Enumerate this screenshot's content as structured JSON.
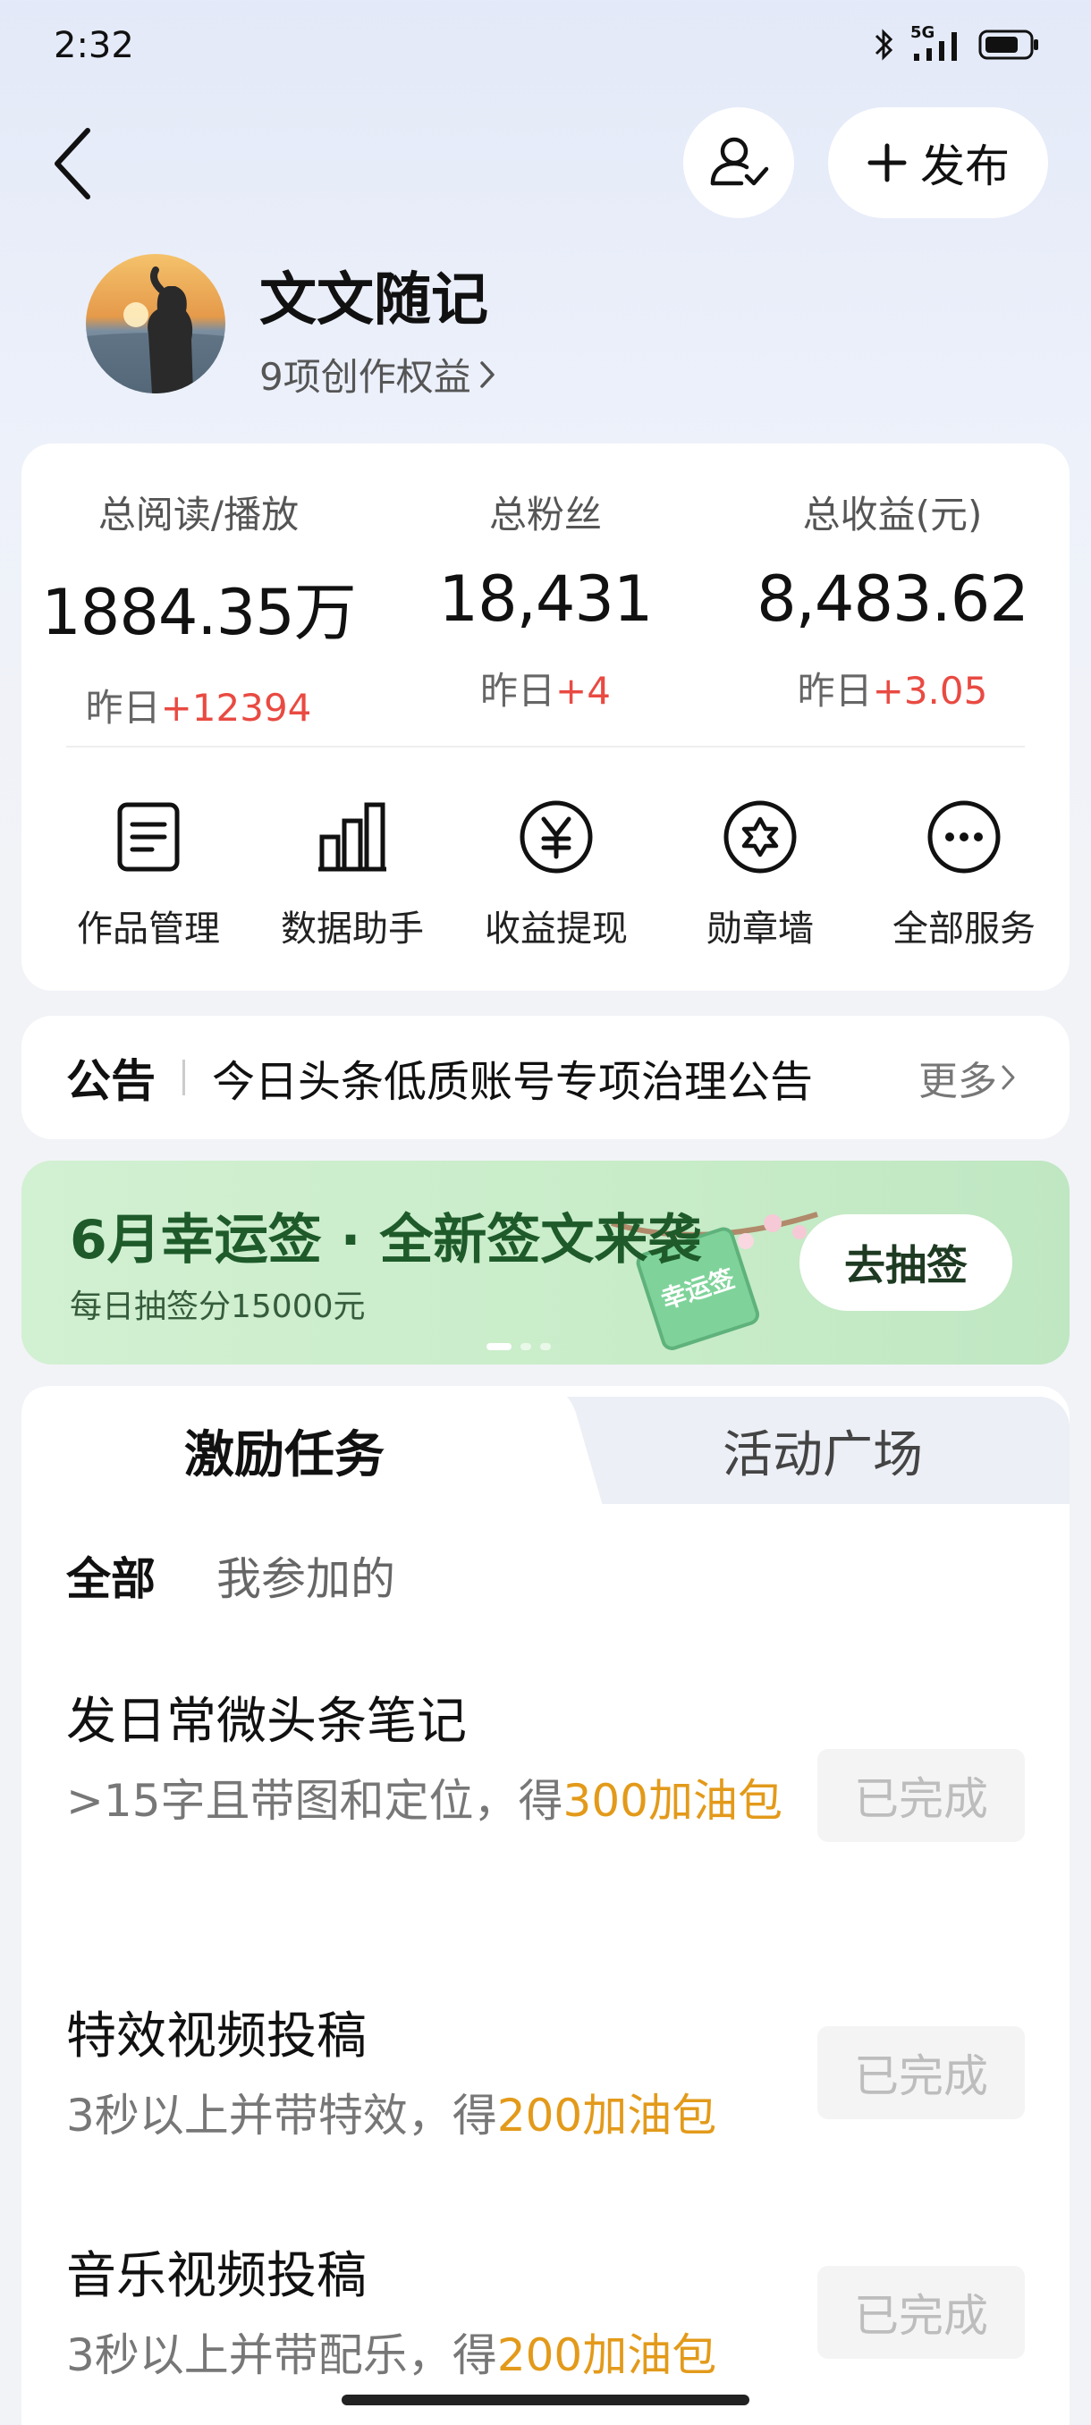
{
  "status_bar": {
    "time": "2:32",
    "network": "5G"
  },
  "header": {
    "publish_label": "发布"
  },
  "profile": {
    "name": "文文随记",
    "rights": "9项创作权益"
  },
  "stats": [
    {
      "label": "总阅读/播放",
      "value": "1884.35万",
      "delta_prefix": "昨日",
      "delta": "+12394"
    },
    {
      "label": "总粉丝",
      "value": "18,431",
      "delta_prefix": "昨日",
      "delta": "+4"
    },
    {
      "label": "总收益(元)",
      "value": "8,483.62",
      "delta_prefix": "昨日",
      "delta": "+3.05"
    }
  ],
  "services": [
    {
      "label": "作品管理",
      "icon": "document-icon"
    },
    {
      "label": "数据助手",
      "icon": "bar-chart-icon"
    },
    {
      "label": "收益提现",
      "icon": "yuan-icon"
    },
    {
      "label": "勋章墙",
      "icon": "badge-icon"
    },
    {
      "label": "全部服务",
      "icon": "more-icon"
    }
  ],
  "notice": {
    "title": "公告",
    "text": "今日头条低质账号专项治理公告",
    "more": "更多"
  },
  "banner": {
    "title": "6月幸运签 · 全新签文来袭",
    "subtitle": "每日抽签分15000元",
    "button": "去抽签",
    "deco_text": "幸运签",
    "accent": "#1e5a2a"
  },
  "tabs": {
    "active": "激励任务",
    "other": "活动广场"
  },
  "filters": {
    "all": "全部",
    "mine": "我参加的"
  },
  "tasks": [
    {
      "title": "发日常微头条笔记",
      "desc_prefix": ">15字且带图和定位，得",
      "reward": "300加油包",
      "status": "已完成"
    },
    {
      "title": "特效视频投稿",
      "desc_prefix": "3秒以上并带特效，得",
      "reward": "200加油包",
      "status": "已完成"
    },
    {
      "title": "音乐视频投稿",
      "desc_prefix": "3秒以上并带配乐，得",
      "reward": "200加油包",
      "status": "已完成"
    }
  ],
  "colors": {
    "highlight_red": "#e94a42",
    "reward_orange": "#e39a1a"
  }
}
